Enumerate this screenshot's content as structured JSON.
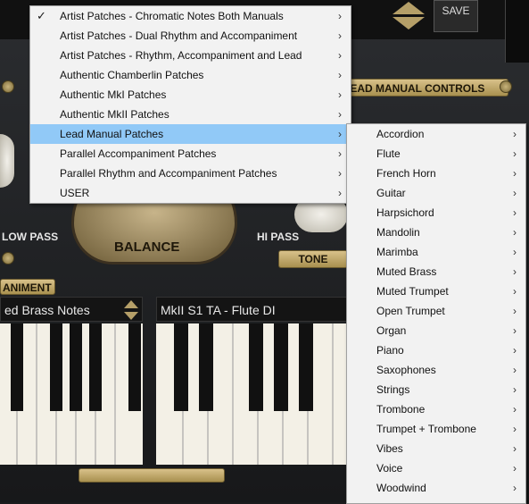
{
  "toolbar": {
    "save_label": "SAVE"
  },
  "panel": {
    "controls_label": "LEAD MANUAL CONTROLS",
    "low_pass": "LOW PASS",
    "hi_pass": "HI PASS",
    "tone": "TONE",
    "balance": "BALANCE",
    "accomp_label": "ANIMENT"
  },
  "keyboards": {
    "left_patch": "ed Brass Notes",
    "right_patch": "MkII  S1  TA - Flute DI"
  },
  "menu": {
    "checked_index": 0,
    "highlighted_index": 6,
    "items": [
      {
        "label": "Artist Patches - Chromatic Notes Both Manuals"
      },
      {
        "label": "Artist Patches - Dual Rhythm and Accompaniment"
      },
      {
        "label": "Artist Patches - Rhythm, Accompaniment and Lead"
      },
      {
        "label": "Authentic Chamberlin Patches"
      },
      {
        "label": "Authentic MkI Patches"
      },
      {
        "label": "Authentic MkII Patches"
      },
      {
        "label": "Lead Manual Patches"
      },
      {
        "label": "Parallel Accompaniment Patches"
      },
      {
        "label": "Parallel Rhythm and Accompaniment Patches"
      },
      {
        "label": "USER"
      }
    ]
  },
  "submenu": {
    "items": [
      {
        "label": "Accordion"
      },
      {
        "label": "Flute"
      },
      {
        "label": "French Horn"
      },
      {
        "label": "Guitar"
      },
      {
        "label": "Harpsichord"
      },
      {
        "label": "Mandolin"
      },
      {
        "label": "Marimba"
      },
      {
        "label": "Muted Brass"
      },
      {
        "label": "Muted Trumpet"
      },
      {
        "label": "Open Trumpet"
      },
      {
        "label": "Organ"
      },
      {
        "label": "Piano"
      },
      {
        "label": "Saxophones"
      },
      {
        "label": "Strings"
      },
      {
        "label": "Trombone"
      },
      {
        "label": "Trumpet + Trombone"
      },
      {
        "label": "Vibes"
      },
      {
        "label": "Voice"
      },
      {
        "label": "Woodwind"
      }
    ]
  },
  "icons": {
    "check": "checkmark-icon",
    "arrow": "chevron-right-icon"
  },
  "colors": {
    "highlight": "#91c9f7",
    "menu_bg": "#f2f2f2",
    "brass": "#c8b070"
  }
}
